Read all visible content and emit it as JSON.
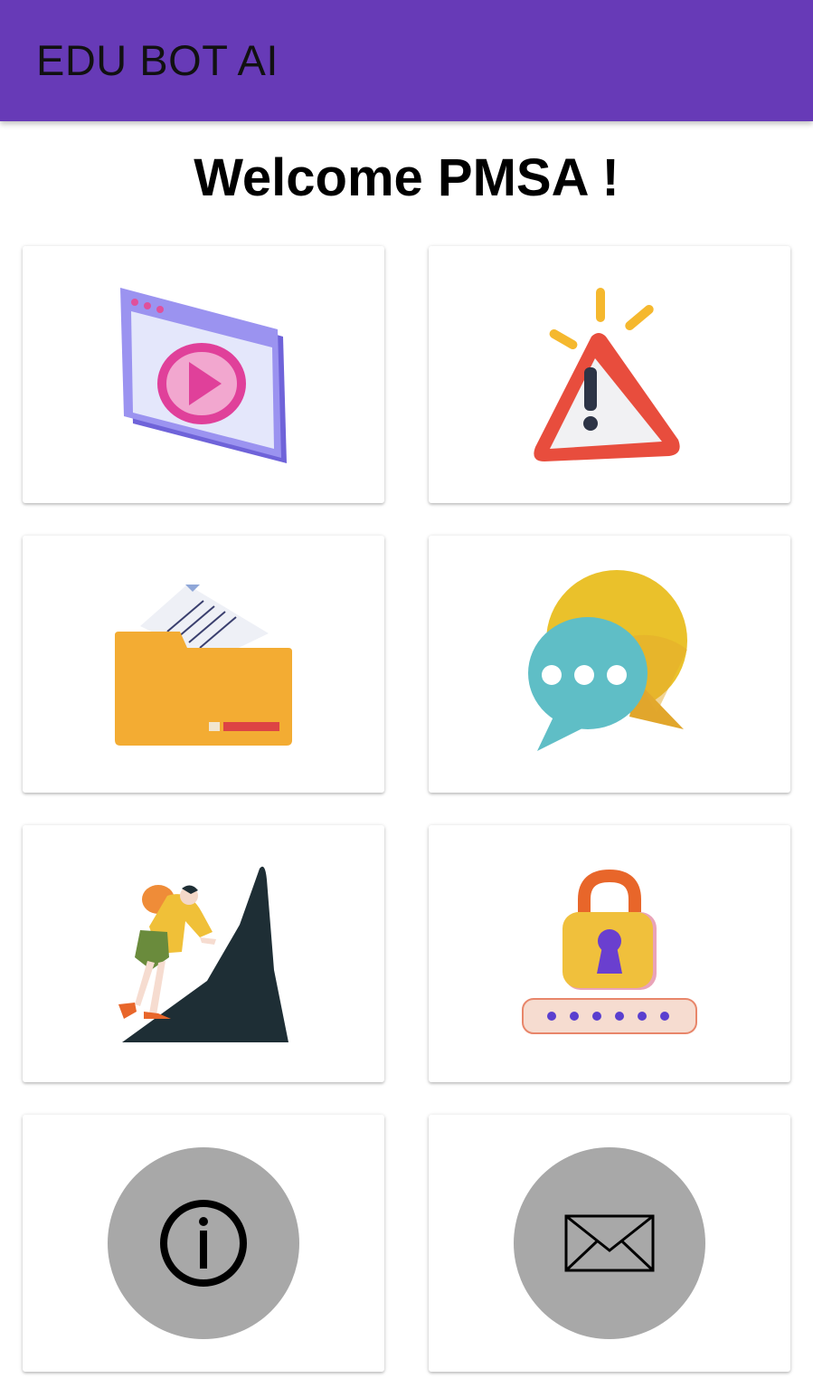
{
  "appbar": {
    "title": "EDU BOT AI",
    "color": "#673ab7"
  },
  "welcome": {
    "text": "Welcome PMSA !"
  },
  "menu_cards": [
    {
      "icon": "video-player-icon"
    },
    {
      "icon": "warning-icon"
    },
    {
      "icon": "folder-document-icon"
    },
    {
      "icon": "chat-bubbles-icon"
    },
    {
      "icon": "mountain-climber-icon"
    },
    {
      "icon": "padlock-password-icon"
    },
    {
      "icon": "info-icon"
    },
    {
      "icon": "mail-envelope-icon"
    }
  ]
}
